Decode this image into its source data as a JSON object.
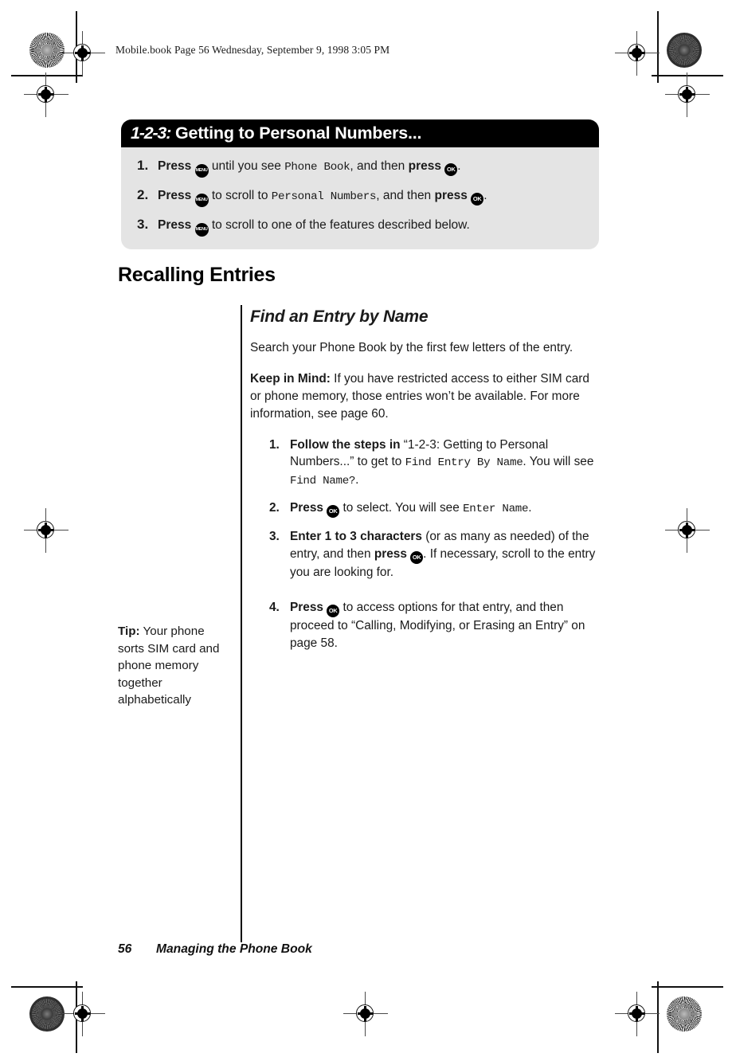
{
  "running_header": "Mobile.book  Page 56  Wednesday, September 9, 1998  3:05 PM",
  "callout": {
    "header_number": "1-2-3:",
    "header_title": "Getting to Personal Numbers...",
    "steps": [
      {
        "number": "1.",
        "press_label": "Press",
        "key1": "MENU",
        "mid_text": " until you see ",
        "screen_text": "Phone Book",
        "tail_text": ", and then ",
        "press2_label": "press",
        "key2": "OK",
        "end_text": "."
      },
      {
        "number": "2.",
        "press_label": "Press",
        "key1": "MENU",
        "mid_text": " to scroll to ",
        "screen_text": "Personal Numbers",
        "tail_text": ", and then ",
        "press2_label": "press",
        "key2": "OK",
        "end_text": "."
      },
      {
        "number": "3.",
        "press_label": "Press",
        "key1": "MENU",
        "mid_text": " to scroll to one of the features described below.",
        "screen_text": "",
        "tail_text": "",
        "press2_label": "",
        "key2": "",
        "end_text": ""
      }
    ]
  },
  "section_title": "Recalling Entries",
  "subsection": {
    "title": "Find an Entry by Name",
    "intro": "Search your Phone Book by the first few letters of the entry.",
    "keep_in_mind_label": "Keep in Mind:",
    "keep_in_mind_text": " If you have restricted access to either SIM card or phone memory, those entries won’t be available. For more information, see page 60.",
    "steps": [
      {
        "number": "1.",
        "bold_lead": "Follow the steps in",
        "part1": " “1-2-3: Getting to Personal Numbers...” to get to ",
        "screen1": "Find Entry By Name",
        "part2": ". You will see ",
        "screen2": "Find Name?",
        "part3": "."
      },
      {
        "number": "2.",
        "bold_lead": "Press",
        "key": "OK",
        "part1": " to  select. You will see ",
        "screen1": "Enter Name",
        "part2": ".",
        "screen2": "",
        "part3": ""
      },
      {
        "number": "3.",
        "bold_lead": "Enter 1 to 3 characters",
        "part1": " (or as many as needed) of the entry, and then ",
        "bold_mid": "press",
        "key": "OK",
        "part2": ". If necessary, scroll to the entry you are looking for.",
        "screen1": "",
        "screen2": "",
        "part3": ""
      },
      {
        "number": "4.",
        "bold_lead": "Press",
        "key": "OK",
        "part1": " to access options for that entry, and then proceed to “Calling, Modifying, or Erasing an Entry” on page 58.",
        "part2": "",
        "screen1": "",
        "screen2": "",
        "part3": ""
      }
    ]
  },
  "tip": {
    "label": "Tip:",
    "text": " Your phone sorts SIM card and phone memory together alphabetically"
  },
  "footer": {
    "page_number": "56",
    "section_name": "Managing the Phone Book"
  },
  "colors": {
    "callout_header_bg": "#000000",
    "callout_body_bg": "#e4e4e4",
    "text": "#1a1a1a",
    "page_bg": "#ffffff"
  }
}
